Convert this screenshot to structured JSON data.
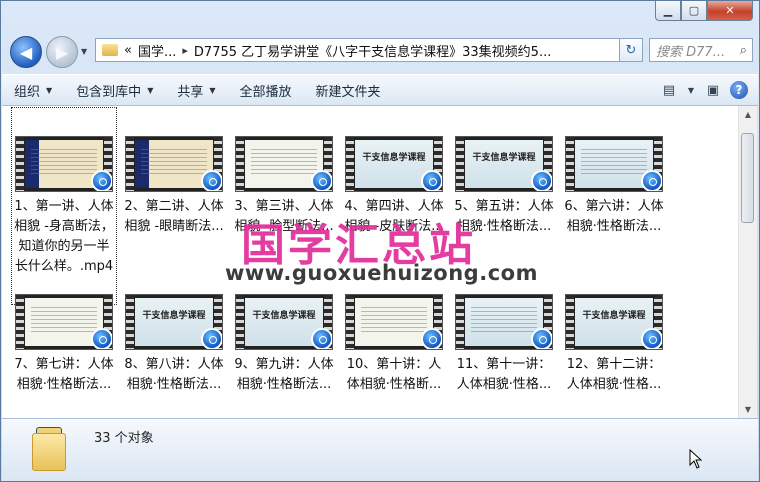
{
  "window": {
    "caption_buttons": [
      "minimize",
      "maximize",
      "close"
    ]
  },
  "address": {
    "crumbs": [
      "«",
      "国学...",
      "D7755 乙丁易学讲堂《八字干支信息学课程》33集视频约5..."
    ],
    "separator": "▸"
  },
  "search": {
    "placeholder": "搜索 D77..."
  },
  "toolbar": {
    "organize": "组织",
    "include_library": "包含到库中",
    "share": "共享",
    "play_all": "全部播放",
    "new_folder": "新建文件夹"
  },
  "files": [
    {
      "name": "1、第一讲、人体相貌 -身高断法，知道你的另一半长什么样。.mp4",
      "thumb": "t1"
    },
    {
      "name": "2、第二讲、人体相貌 -眼睛断法...",
      "thumb": "t1"
    },
    {
      "name": "3、第三讲、人体相貌 -脸型断法...",
      "thumb": "t3"
    },
    {
      "name": "4、第四讲、人体相貌 -皮肤断法...",
      "thumb": "t2",
      "title": "干支信息学课程"
    },
    {
      "name": "5、第五讲：人体相貌·性格断法...",
      "thumb": "t2",
      "title": "干支信息学课程"
    },
    {
      "name": "6、第六讲：人体相貌·性格断法...",
      "thumb": "t2"
    },
    {
      "name": "7、第七讲：人体相貌·性格断法...",
      "thumb": "t3"
    },
    {
      "name": "8、第八讲：人体相貌·性格断法...",
      "thumb": "t2",
      "title": "干支信息学课程"
    },
    {
      "name": "9、第九讲：人体相貌·性格断法...",
      "thumb": "t2",
      "title": "干支信息学课程"
    },
    {
      "name": "10、第十讲：人体相貌·性格断...",
      "thumb": "t3"
    },
    {
      "name": "11、第十一讲：人体相貌·性格...",
      "thumb": "t2"
    },
    {
      "name": "12、第十二讲：人体相貌·性格...",
      "thumb": "t2",
      "title": "干支信息学课程"
    }
  ],
  "watermark": {
    "cn": "国学汇总站",
    "url": "www.guoxuehuizong.com",
    "color": "#e12d9a"
  },
  "status": {
    "count": "33 个对象"
  }
}
